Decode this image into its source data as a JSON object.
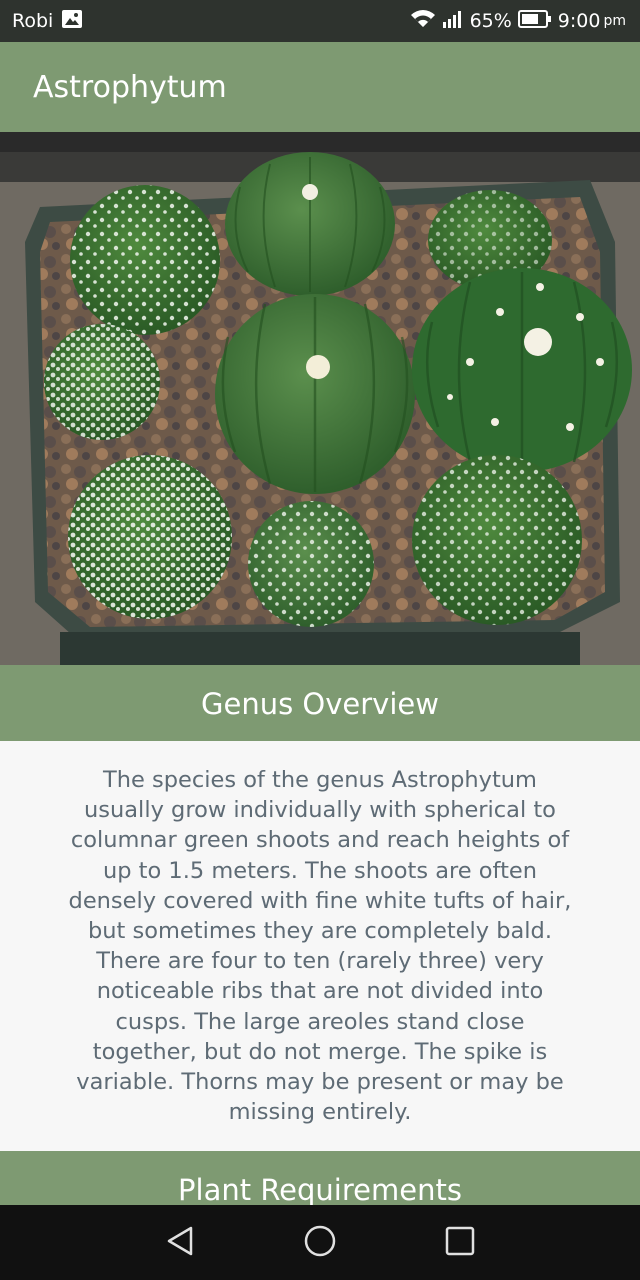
{
  "status_bar": {
    "carrier": "Robi",
    "battery": "65%",
    "time": "9:00",
    "ampm": "pm",
    "icons": [
      "image-notification-icon",
      "wifi-icon",
      "signal-icon",
      "battery-icon"
    ]
  },
  "app_bar": {
    "title": "Astrophytum"
  },
  "hero_image": {
    "subject": "astrophytum-cactus-photo"
  },
  "sections": {
    "overview": {
      "title": "Genus Overview",
      "body": "The species of the genus Astrophytum usually grow individually with spherical to columnar green shoots and reach heights of up to 1.5 meters. The shoots are often densely covered with fine white tufts of hair, but sometimes they are completely bald. There are four to ten (rarely three) very noticeable ribs that are not divided into cusps. The large areoles stand close together, but do not merge. The spike is variable. Thorns may be present or may be missing entirely."
    },
    "requirements": {
      "title": "Plant Requirements"
    }
  },
  "nav_bar": {
    "icons": [
      "back-icon",
      "home-icon",
      "recents-icon"
    ]
  },
  "colors": {
    "accent": "#7e9a72",
    "status_bar": "#2e332e",
    "body_text": "#5e6b75",
    "nav_bar": "#111111"
  }
}
